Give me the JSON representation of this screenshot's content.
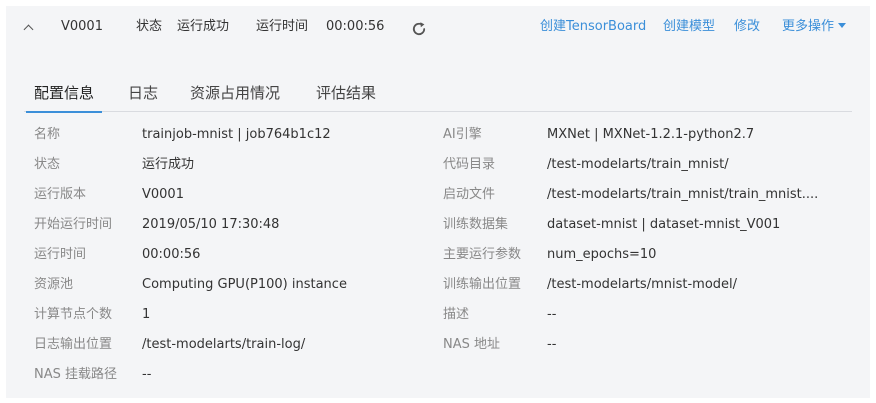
{
  "header": {
    "version": "V0001",
    "status_label": "状态",
    "status_value": "运行成功",
    "runtime_label": "运行时间",
    "runtime_value": "00:00:56",
    "actions": {
      "create_tensorboard": "创建TensorBoard",
      "create_model": "创建模型",
      "edit": "修改",
      "more": "更多操作"
    }
  },
  "tabs": [
    "配置信息",
    "日志",
    "资源占用情况",
    "评估结果"
  ],
  "left": [
    {
      "label": "名称",
      "value": "trainjob-mnist | job764b1c12"
    },
    {
      "label": "状态",
      "value": "运行成功"
    },
    {
      "label": "运行版本",
      "value": "V0001"
    },
    {
      "label": "开始运行时间",
      "value": "2019/05/10 17:30:48"
    },
    {
      "label": "运行时间",
      "value": "00:00:56"
    },
    {
      "label": "资源池",
      "value": "Computing GPU(P100) instance"
    },
    {
      "label": "计算节点个数",
      "value": "1"
    },
    {
      "label": "日志输出位置",
      "value": "/test-modelarts/train-log/"
    },
    {
      "label": "NAS 挂载路径",
      "value": "--"
    }
  ],
  "right": [
    {
      "label": "AI引擎",
      "value": "MXNet | MXNet-1.2.1-python2.7"
    },
    {
      "label": "代码目录",
      "value": "/test-modelarts/train_mnist/"
    },
    {
      "label": "启动文件",
      "value": "/test-modelarts/train_mnist/train_mnist...."
    },
    {
      "label": "训练数据集",
      "value": "dataset-mnist | dataset-mnist_V001"
    },
    {
      "label": "主要运行参数",
      "value": "num_epochs=10"
    },
    {
      "label": "训练输出位置",
      "value": "/test-modelarts/mnist-model/"
    },
    {
      "label": "描述",
      "value": "--"
    },
    {
      "label": "NAS 地址",
      "value": "--"
    }
  ]
}
